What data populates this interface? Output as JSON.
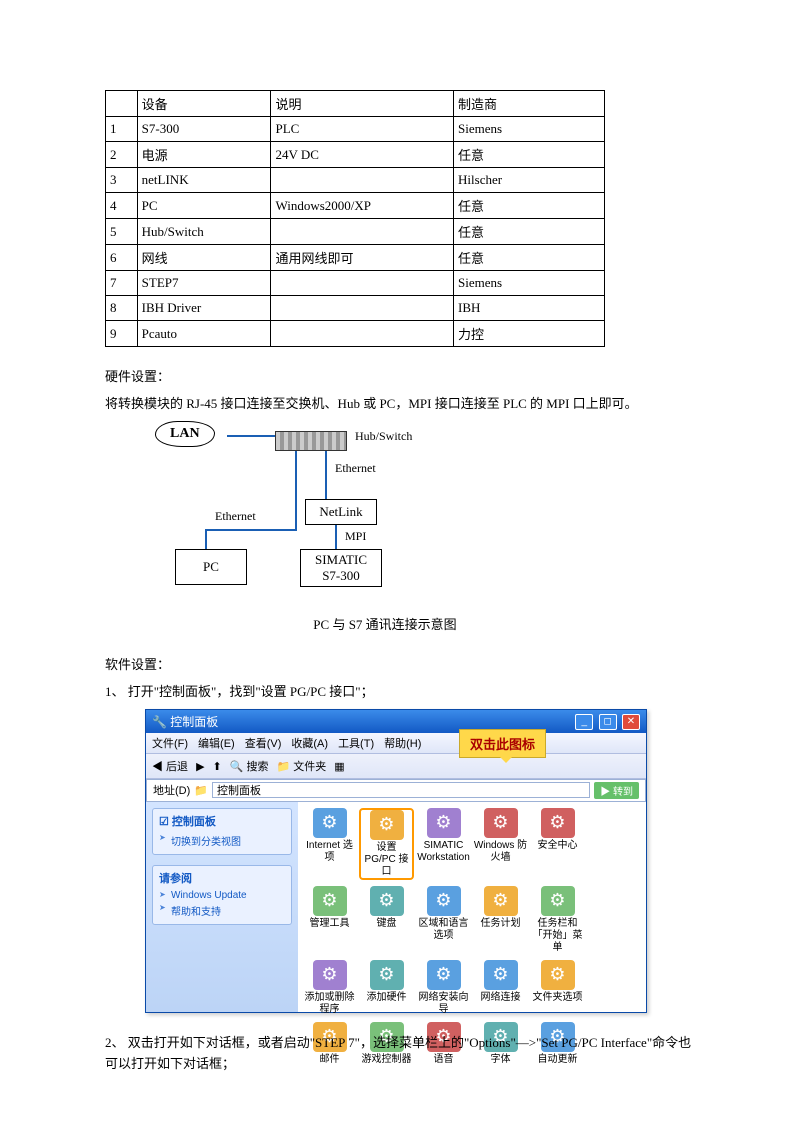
{
  "table": {
    "headers": [
      "",
      "设备",
      "说明",
      "制造商"
    ],
    "rows": [
      [
        "1",
        "S7-300",
        "PLC",
        "Siemens"
      ],
      [
        "2",
        "电源",
        "24V DC",
        "任意"
      ],
      [
        "3",
        "netLINK",
        "",
        "Hilscher"
      ],
      [
        "4",
        "PC",
        "Windows2000/XP",
        "任意"
      ],
      [
        "5",
        "Hub/Switch",
        "",
        "任意"
      ],
      [
        "6",
        "网线",
        "通用网线即可",
        "任意"
      ],
      [
        "7",
        "STEP7",
        "",
        "Siemens"
      ],
      [
        "8",
        "IBH Driver",
        "",
        "IBH"
      ],
      [
        "9",
        "Pcauto",
        "",
        "力控"
      ]
    ]
  },
  "hw_title": "硬件设置：",
  "hw_text": "将转换模块的 RJ-45 接口连接至交换机、Hub 或 PC，MPI 接口连接至 PLC 的 MPI 口上即可。",
  "diagram": {
    "lan": "LAN",
    "hubswitch": "Hub/Switch",
    "ethernet": "Ethernet",
    "netlink": "NetLink",
    "mpi": "MPI",
    "pc": "PC",
    "simatic": "SIMATIC\nS7-300",
    "caption": "PC 与 S7 通讯连接示意图"
  },
  "sw_title": "软件设置：",
  "sw_step1": "1、 打开\"控制面板\"，找到\"设置 PG/PC 接口\"；",
  "sw_step2": "2、 双击打开如下对话框，或者启动\"STEP 7\"，选择菜单栏上的\"Options\"—>\"Set PG/PC Interface\"命令也可以打开如下对话框；",
  "cp": {
    "title": "控制面板",
    "callout": "双击此图标",
    "menu": [
      "文件(F)",
      "编辑(E)",
      "查看(V)",
      "收藏(A)",
      "工具(T)",
      "帮助(H)"
    ],
    "toolbar": [
      "◀ 后退",
      "▶",
      "⬆",
      "🔍 搜索",
      "📁 文件夹",
      "▦"
    ],
    "addr_label": "地址(D)",
    "addr_value": "控制面板",
    "go_label": "转到",
    "side1_hd": "控制面板",
    "side1_it": "切换到分类视图",
    "side2_hd": "请参阅",
    "side2_it1": "Windows Update",
    "side2_it2": "帮助和支持",
    "icons": [
      {
        "label": "Internet 选项",
        "g": "g2"
      },
      {
        "label": "设置 PG/PC 接口",
        "g": "g1",
        "hl": true
      },
      {
        "label": "SIMATIC Workstation",
        "g": "g5"
      },
      {
        "label": "Windows 防火墙",
        "g": "g4"
      },
      {
        "label": "安全中心",
        "g": "g4"
      },
      {
        "label": "",
        "g": ""
      },
      {
        "label": "管理工具",
        "g": "g3"
      },
      {
        "label": "键盘",
        "g": "g6"
      },
      {
        "label": "区域和语言选项",
        "g": "g2"
      },
      {
        "label": "任务计划",
        "g": "g1"
      },
      {
        "label": "任务栏和「开始」菜单",
        "g": "g3"
      },
      {
        "label": "",
        "g": ""
      },
      {
        "label": "添加或删除程序",
        "g": "g5"
      },
      {
        "label": "添加硬件",
        "g": "g6"
      },
      {
        "label": "网络安装向导",
        "g": "g2"
      },
      {
        "label": "网络连接",
        "g": "g2"
      },
      {
        "label": "文件夹选项",
        "g": "g1"
      },
      {
        "label": "",
        "g": ""
      },
      {
        "label": "邮件",
        "g": "g1"
      },
      {
        "label": "游戏控制器",
        "g": "g3"
      },
      {
        "label": "语音",
        "g": "g4"
      },
      {
        "label": "字体",
        "g": "g6"
      },
      {
        "label": "自动更新",
        "g": "g2"
      },
      {
        "label": "",
        "g": ""
      }
    ]
  }
}
